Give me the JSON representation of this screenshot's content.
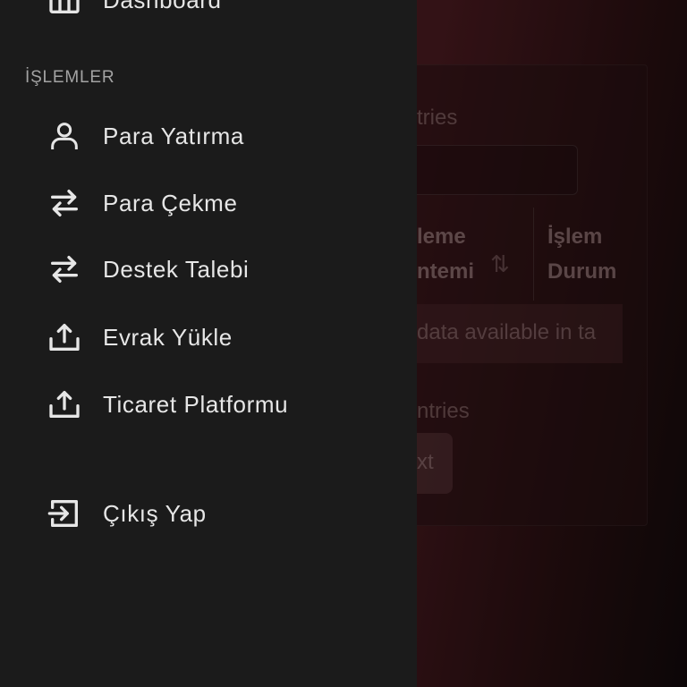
{
  "drawer": {
    "top_item": {
      "label": "Dashboard",
      "icon": "grid-icon"
    },
    "section_header": "İŞLEMLER",
    "items": [
      {
        "label": "Para Yatırma",
        "icon": "user-icon"
      },
      {
        "label": "Para Çekme",
        "icon": "swap-arrows-icon"
      },
      {
        "label": "Destek Talebi",
        "icon": "swap-arrows-icon"
      },
      {
        "label": "Evrak Yükle",
        "icon": "upload-icon"
      },
      {
        "label": "Ticaret Platformu",
        "icon": "upload-icon"
      }
    ],
    "logout": {
      "label": "Çıkış Yap",
      "icon": "logout-icon"
    }
  },
  "background": {
    "show_entries_fragment": "tries",
    "col_method_line1": "leme",
    "col_method_line2": "ntemi",
    "col_status_line1": "İşlem",
    "col_status_line2": "Durum",
    "empty_fragment": "data available in ta",
    "showing_fragment": "ntries",
    "next_fragment": "xt"
  },
  "colors": {
    "drawer_bg": "#1b1b1b",
    "drawer_text": "#e6e6e6",
    "section_text": "#a3a3a3",
    "page_accent": "#4a1a20"
  }
}
